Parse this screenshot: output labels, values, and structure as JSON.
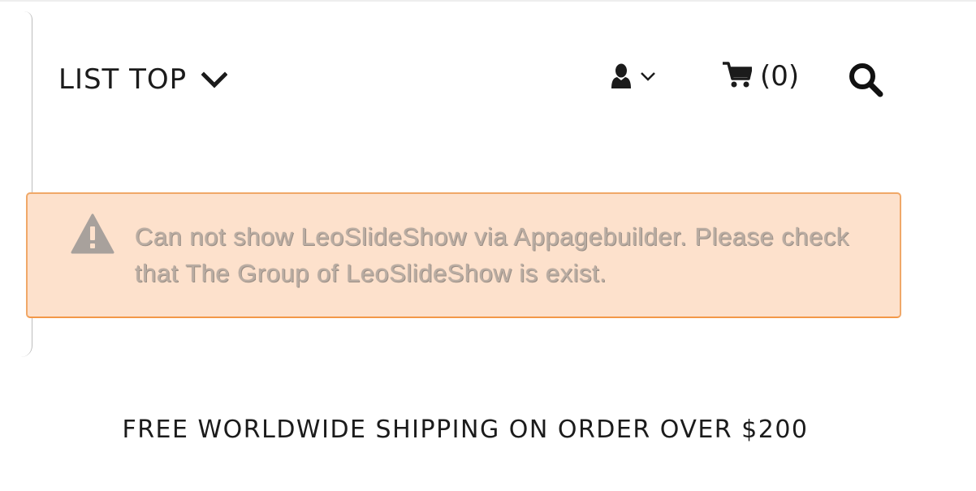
{
  "header": {
    "menu_label": "LIST TOP",
    "menu_icon": "chevron-down-icon",
    "user_icon": "user-icon",
    "user_menu_icon": "chevron-down-icon",
    "cart_icon": "shopping-cart-icon",
    "cart_count": "(0)",
    "search_icon": "search-icon"
  },
  "alert": {
    "icon": "warning-icon",
    "message": "Can not show LeoSlideShow via Appagebuilder. Please check that The Group of LeoSlideShow is exist.",
    "background": "#fde1cc",
    "border": "#f39848"
  },
  "banner": {
    "text": "FREE WORLDWIDE SHIPPING ON ORDER OVER $200"
  },
  "colors": {
    "text": "#1b1b1b",
    "alert_text": "#b9aca2"
  }
}
